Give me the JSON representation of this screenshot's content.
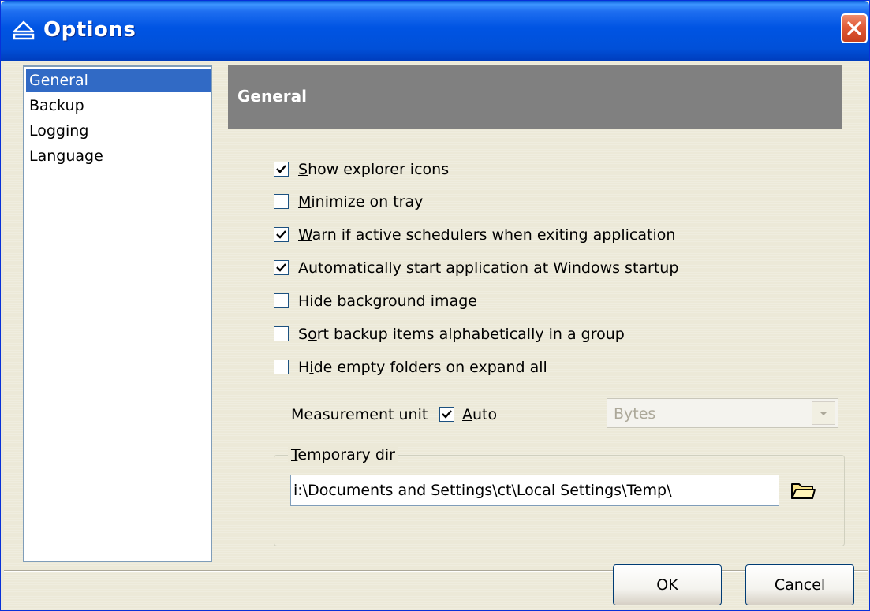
{
  "window": {
    "title": "Options"
  },
  "nav": {
    "items": [
      {
        "label": "General",
        "selected": true
      },
      {
        "label": "Backup",
        "selected": false
      },
      {
        "label": "Logging",
        "selected": false
      },
      {
        "label": "Language",
        "selected": false
      }
    ]
  },
  "panel": {
    "header": "General",
    "checkboxes": [
      {
        "label": "Show explorer icons",
        "accel": "S",
        "rest": "how explorer icons",
        "prefix": "",
        "checked": true
      },
      {
        "label": "Minimize on tray",
        "accel": "M",
        "rest": "inimize on tray",
        "prefix": "",
        "checked": false
      },
      {
        "label": "Warn if active schedulers when exiting application",
        "accel": "W",
        "rest": "arn if active schedulers when exiting application",
        "prefix": "",
        "checked": true
      },
      {
        "label": "Automatically start application at Windows startup",
        "prefix": "A",
        "accel": "u",
        "rest": "tomatically start application at Windows startup",
        "checked": true
      },
      {
        "label": "Hide background image",
        "accel": "H",
        "rest": "ide background image",
        "prefix": "",
        "checked": false
      },
      {
        "label": "Sort backup items alphabetically in a group",
        "prefix": "S",
        "accel": "o",
        "rest": "rt backup items alphabetically in a group",
        "checked": false
      },
      {
        "label": "Hide empty folders on expand all",
        "prefix": "H",
        "accel": "i",
        "rest": "de empty folders on expand all",
        "checked": false
      }
    ],
    "measurement": {
      "label": "Measurement unit",
      "auto_label": "Auto",
      "auto_accel": "A",
      "auto_rest": "uto",
      "auto_checked": true,
      "unit_value": "Bytes"
    },
    "temp_dir": {
      "group_label": "Temporary dir",
      "group_accel": "T",
      "group_rest": "emporary dir",
      "path": "i:\\Documents and Settings\\ct\\Local Settings\\Temp\\"
    }
  },
  "buttons": {
    "ok": "OK",
    "cancel": "Cancel"
  },
  "colors": {
    "title_bar": "#0054e3",
    "selection": "#316ac5",
    "header_band": "#808080",
    "dialog_bg": "#ece9d8"
  },
  "icons": {
    "title": "eject-icon",
    "close": "close-icon",
    "browse": "folder-icon",
    "check": "checkmark-icon",
    "dropdown": "chevron-down-icon"
  }
}
